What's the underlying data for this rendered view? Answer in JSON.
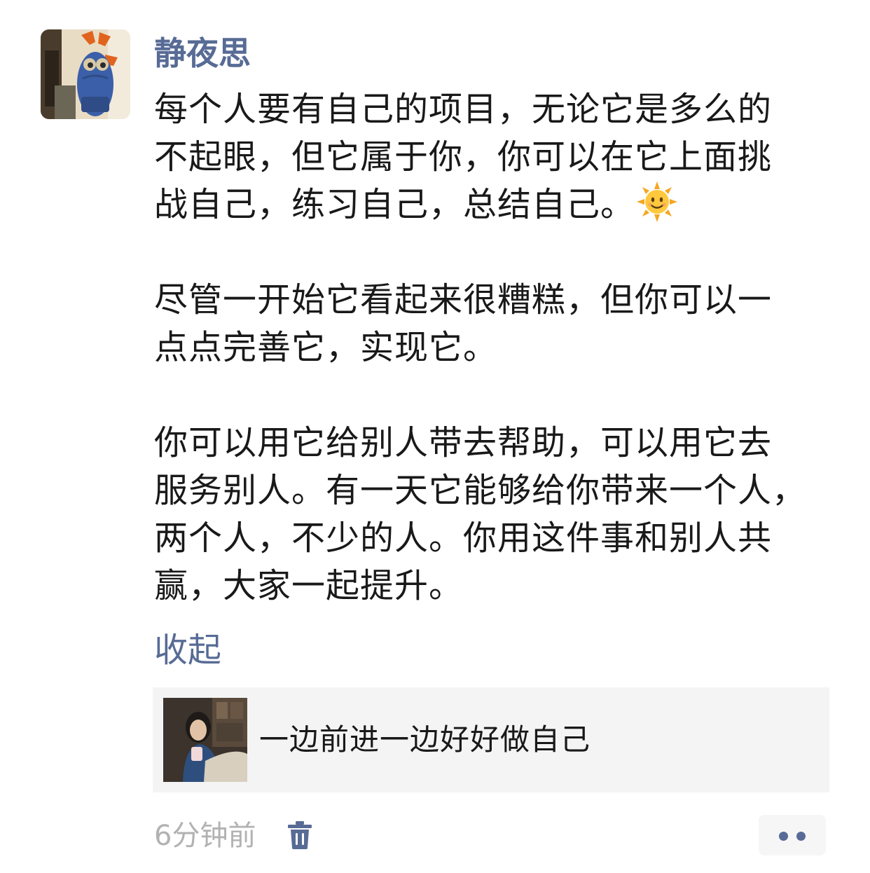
{
  "post": {
    "author": "静夜思",
    "paragraphs": [
      [
        "每个人要有自己的项目，无论它是多么的",
        "不起眼，但它属于你，你可以在它上面挑",
        "战自己，练习自己，总结自己。"
      ],
      [
        "尽管一开始它看起来很糟糕，但你可以一",
        "点点完善它，实现它。"
      ],
      [
        "你可以用它给别人带去帮助，可以用它去",
        "服务别人。有一天它能够给你带来一个人，",
        "两个人，不少的人。你用这件事和别人共",
        "赢，大家一起提升。"
      ]
    ],
    "emoji_icon": "sun-with-face-icon",
    "collapse_label": "收起"
  },
  "shared_card": {
    "title": "一边前进一边好好做自己"
  },
  "footer": {
    "timestamp": "6分钟前",
    "delete_icon": "trash-icon",
    "more_icon": "more-dots-icon"
  },
  "colors": {
    "link": "#576b95",
    "text": "#191919",
    "muted": "#b2b2b2",
    "card_bg": "#f4f4f4"
  }
}
